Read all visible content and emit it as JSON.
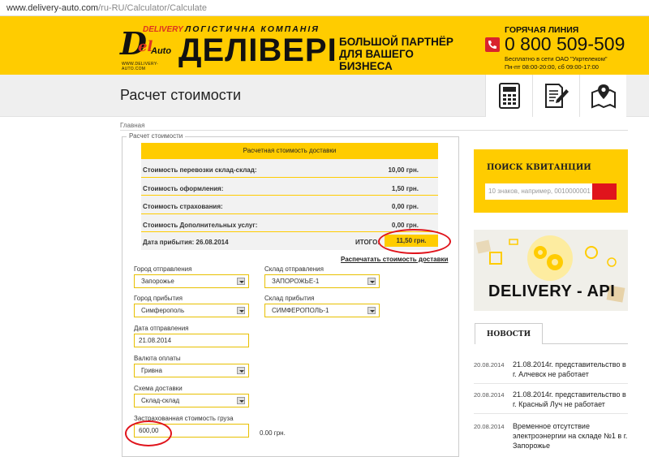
{
  "browser": {
    "domain": "www.delivery-auto.com",
    "path": "/ru-RU/Calculator/Calculate"
  },
  "header": {
    "logo_delivery": "DELIVERY",
    "logo_d": "D",
    "logo_el": "el",
    "logo_auto": "Auto",
    "logo_site": "WWW.DELIVERY-AUTO.COM",
    "company_sub": "ЛОГІСТИЧНА КОМПАНІЯ",
    "company": "ДЕЛІВЕРІ",
    "slogan_line1": "БОЛЬШОЙ ПАРТНЁР",
    "slogan_line2": "ДЛЯ ВАШЕГО БИЗНЕСА",
    "hotline_title": "ГОРЯЧАЯ ЛИНИЯ",
    "phone": "0 800 509-509",
    "hotline_sub1": "Бесплатно в сети ОАО \"Укртелеком\"",
    "hotline_sub2": "Пн-пт 08:00-20:00, сб 09:00-17:00"
  },
  "page": {
    "title": "Расчет стоимости",
    "breadcrumb": "Главная",
    "legend": "Расчет стоимости"
  },
  "result": {
    "header": "Расчетная стоимость доставки",
    "rows": [
      {
        "label": "Стоимость перевозки склад-склад:",
        "value": "10,00 грн."
      },
      {
        "label": "Стоимость оформления:",
        "value": "1,50 грн."
      },
      {
        "label": "Стоимость страхования:",
        "value": "0,00 грн."
      },
      {
        "label": "Стоимость Дополнительных услуг:",
        "value": "0,00 грн."
      }
    ],
    "arrival_label": "Дата прибытия: 26.08.2014",
    "total_label": "ИТОГО:",
    "total_value": "11,50 грн.",
    "print_link": "Распечатать стоимость доставки"
  },
  "form": {
    "city_from_label": "Город отправления",
    "city_from": "Запорожье",
    "warehouse_from_label": "Склад отправления",
    "warehouse_from": "ЗАПОРОЖЬЕ-1",
    "city_to_label": "Город прибытия",
    "city_to": "Симферополь",
    "warehouse_to_label": "Склад прибытия",
    "warehouse_to": "СИМФЕРОПОЛЬ-1",
    "date_label": "Дата отправления",
    "date": "21.08.2014",
    "currency_label": "Валюта оплаты",
    "currency": "Гривна",
    "scheme_label": "Схема доставки",
    "scheme": "Склад-склад",
    "insured_label": "Застрахованная стоимость груза",
    "insured": "600,00",
    "insured_grn": "0.00 грн."
  },
  "sidebar": {
    "search_title": "ПОИСК КВИТАНЦИИ",
    "search_placeholder": "10 знаков, например, 0010000001",
    "api_text": "DELIVERY - API",
    "news_tab": "НОВОСТИ",
    "news": [
      {
        "date": "20.08.2014",
        "text": "21.08.2014г. представительство в г. Алчевск не работает"
      },
      {
        "date": "20.08.2014",
        "text": "21.08.2014г. представительство в г. Красный Луч не работает"
      },
      {
        "date": "20.08.2014",
        "text": "Временное отсутствие электроэнергии на складе №1 в г. Запорожье"
      }
    ]
  },
  "colors": {
    "brand_yellow": "#ffcc00",
    "accent_red": "#e0141c"
  },
  "icons": [
    "calculator-icon",
    "document-pen-icon",
    "map-pin-icon",
    "phone-icon",
    "gear-icon"
  ]
}
